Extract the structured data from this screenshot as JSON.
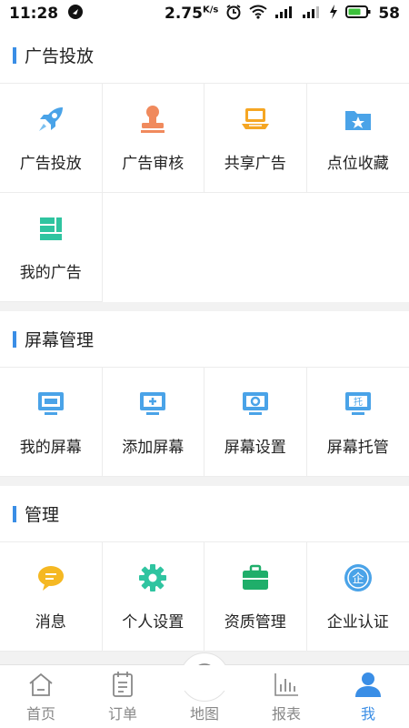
{
  "status_bar": {
    "time": "11:28",
    "network_speed": "2.75",
    "network_unit": "K/s",
    "battery": "58"
  },
  "sections": [
    {
      "title": "广告投放",
      "items": [
        {
          "label": "广告投放",
          "icon": "rocket-icon",
          "color": "#4aa3e8"
        },
        {
          "label": "广告审核",
          "icon": "stamp-icon",
          "color": "#f08a5d"
        },
        {
          "label": "共享广告",
          "icon": "shared-laptop-icon",
          "color": "#f5a623"
        },
        {
          "label": "点位收藏",
          "icon": "folder-star-icon",
          "color": "#4aa3e8"
        },
        {
          "label": "我的广告",
          "icon": "layout-blocks-icon",
          "color": "#2fc4a0"
        }
      ]
    },
    {
      "title": "屏幕管理",
      "items": [
        {
          "label": "我的屏幕",
          "icon": "monitor-icon",
          "color": "#4aa3e8"
        },
        {
          "label": "添加屏幕",
          "icon": "monitor-plus-icon",
          "color": "#4aa3e8"
        },
        {
          "label": "屏幕设置",
          "icon": "monitor-settings-icon",
          "color": "#4aa3e8"
        },
        {
          "label": "屏幕托管",
          "icon": "monitor-hosting-icon",
          "color": "#4aa3e8",
          "badge": "托"
        }
      ]
    },
    {
      "title": "管理",
      "items": [
        {
          "label": "消息",
          "icon": "message-icon",
          "color": "#f5b823"
        },
        {
          "label": "个人设置",
          "icon": "gear-icon",
          "color": "#2fc4a0"
        },
        {
          "label": "资质管理",
          "icon": "briefcase-icon",
          "color": "#1fae6a"
        },
        {
          "label": "企业认证",
          "icon": "enterprise-badge-icon",
          "color": "#4aa3e8",
          "badge": "企"
        }
      ]
    }
  ],
  "tabbar": {
    "active_color": "#3a8ee6",
    "tabs": [
      {
        "label": "首页",
        "icon": "home-icon"
      },
      {
        "label": "订单",
        "icon": "order-icon"
      },
      {
        "label": "地图",
        "icon": "map-pin-icon"
      },
      {
        "label": "报表",
        "icon": "bar-chart-icon"
      },
      {
        "label": "我",
        "icon": "user-icon",
        "active": true
      }
    ]
  }
}
